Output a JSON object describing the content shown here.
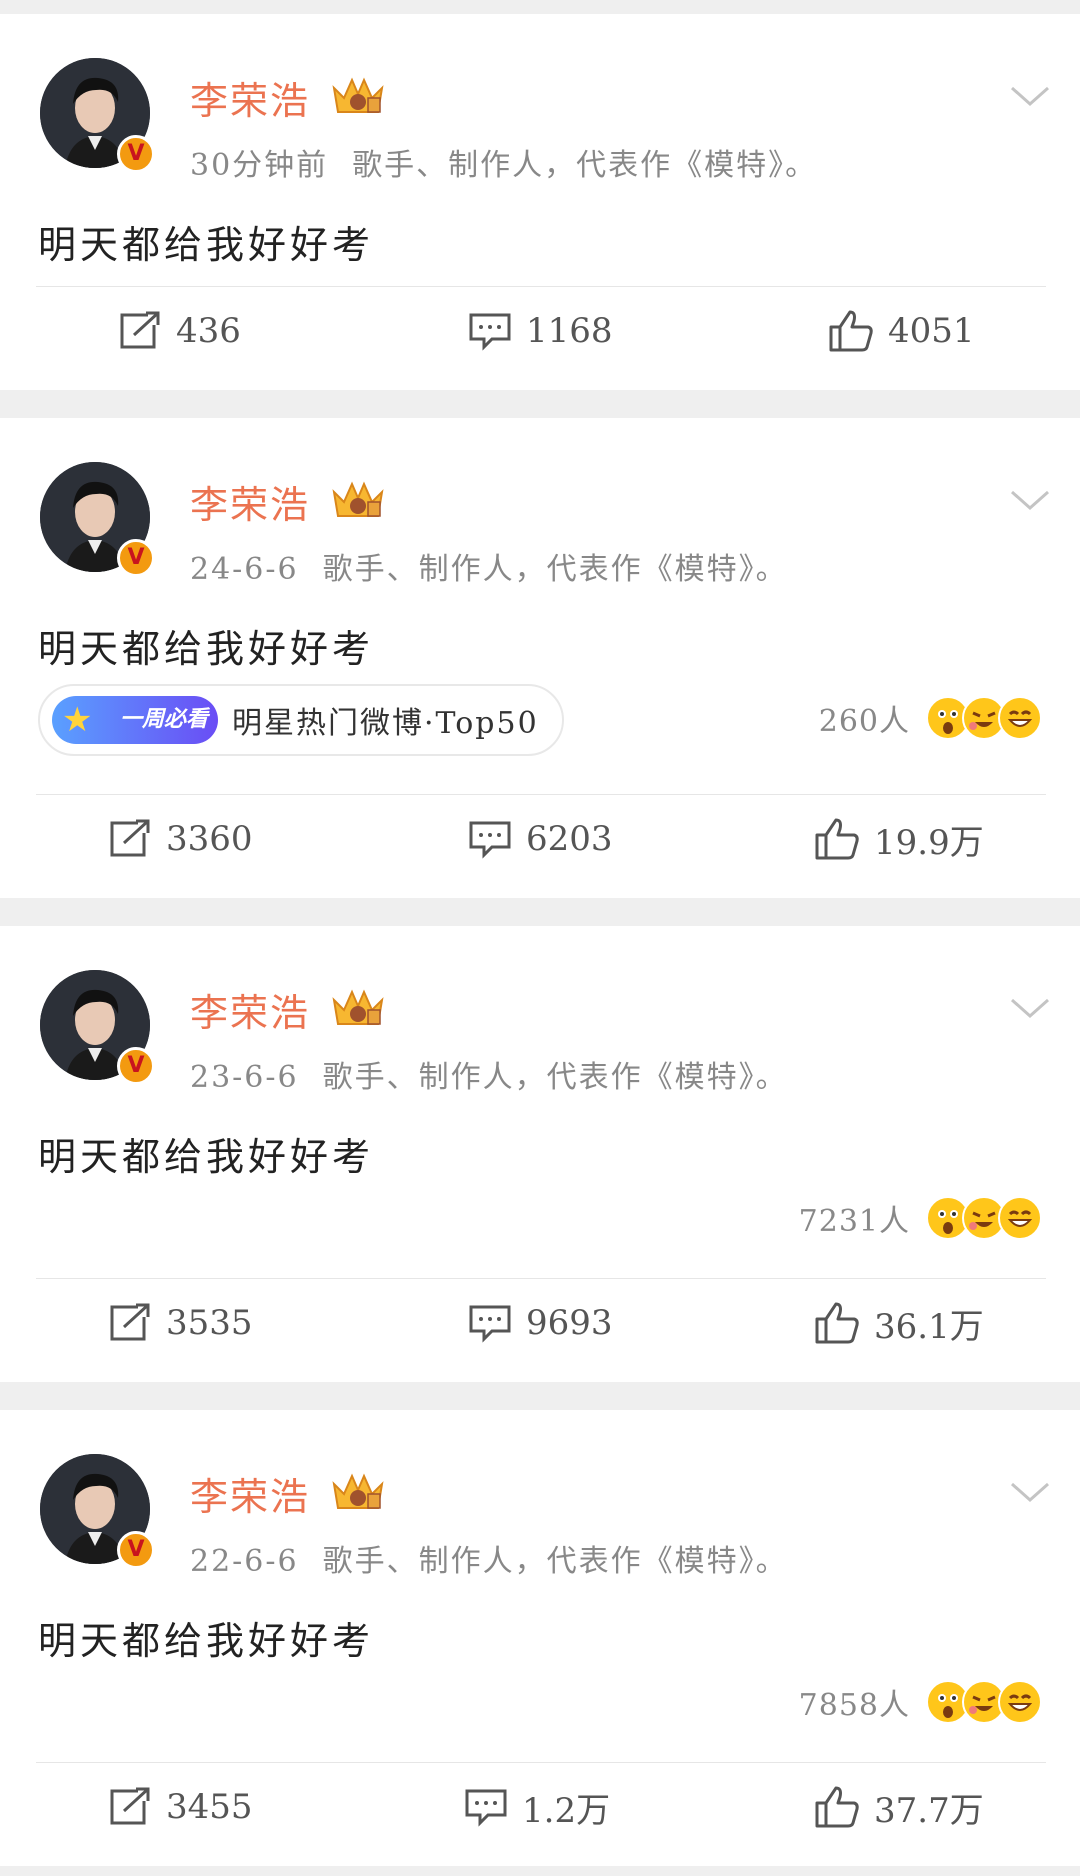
{
  "posts": [
    {
      "name": "李荣浩",
      "time": "30分钟前",
      "bio": "歌手、制作人，代表作《模特》。",
      "content": "明天都给我好好考",
      "reposts": "436",
      "comments": "1168",
      "likes": "4051"
    },
    {
      "name": "李荣浩",
      "time": "24-6-6",
      "bio": "歌手、制作人，代表作《模特》。",
      "content": "明天都给我好好考",
      "hot_badge": "一周必看",
      "hot_text": "明星热门微博·Top50",
      "reaction_count": "260人",
      "reposts": "3360",
      "comments": "6203",
      "likes": "19.9万"
    },
    {
      "name": "李荣浩",
      "time": "23-6-6",
      "bio": "歌手、制作人，代表作《模特》。",
      "content": "明天都给我好好考",
      "reaction_count": "7231人",
      "reposts": "3535",
      "comments": "9693",
      "likes": "36.1万"
    },
    {
      "name": "李荣浩",
      "time": "22-6-6",
      "bio": "歌手、制作人，代表作《模特》。",
      "content": "明天都给我好好考",
      "reaction_count": "7858人",
      "reposts": "3455",
      "comments": "1.2万",
      "likes": "37.7万"
    }
  ],
  "icons": {
    "repost": "repost-icon",
    "comment": "comment-icon",
    "like": "like-icon",
    "more": "chevron-down-icon",
    "verified": "verified-badge-icon",
    "crown": "crown-badge-icon"
  },
  "colors": {
    "name": "#eb7350",
    "meta": "#888888",
    "separator": "#efefef",
    "verified": "#f39a10"
  }
}
